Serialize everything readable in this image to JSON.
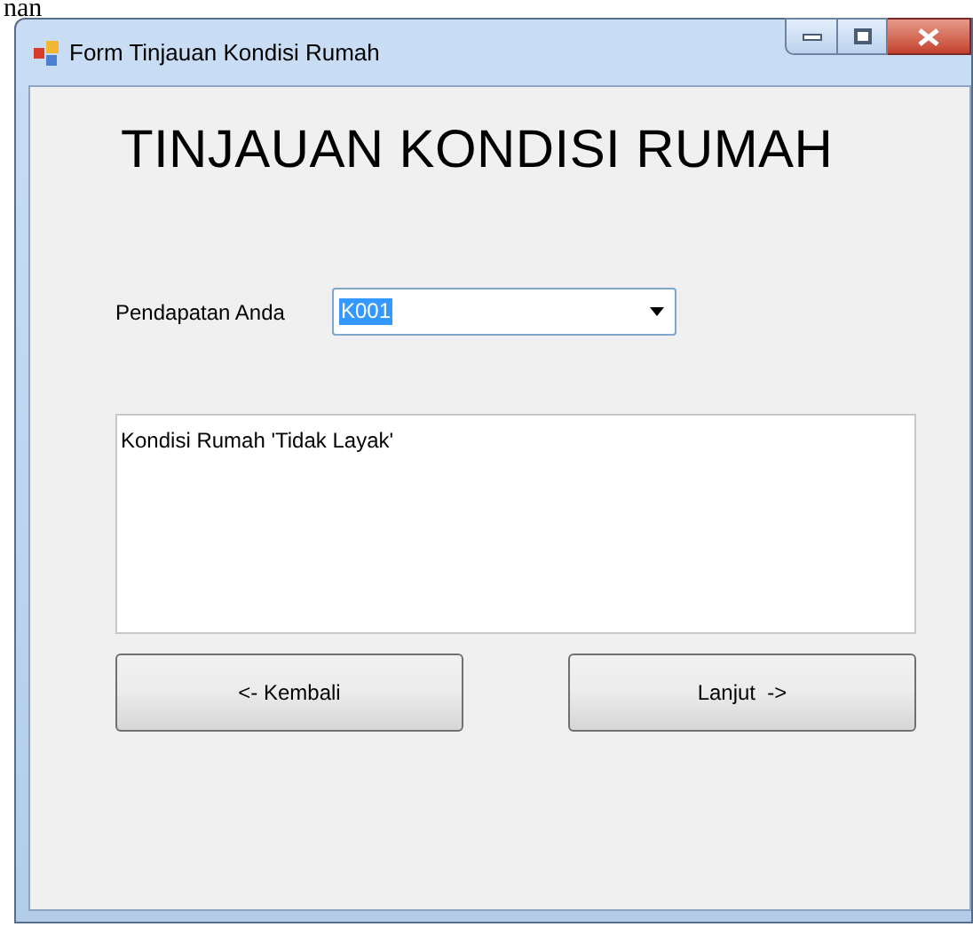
{
  "page_fragment": "nan",
  "window": {
    "title": "Form Tinjauan Kondisi Rumah"
  },
  "heading": "TINJAUAN KONDISI RUMAH",
  "income": {
    "label": "Pendapatan Anda",
    "value": "K001"
  },
  "result": {
    "value": "Kondisi Rumah 'Tidak Layak'"
  },
  "buttons": [
    "<- Kembali",
    "Lanjut  ->"
  ]
}
